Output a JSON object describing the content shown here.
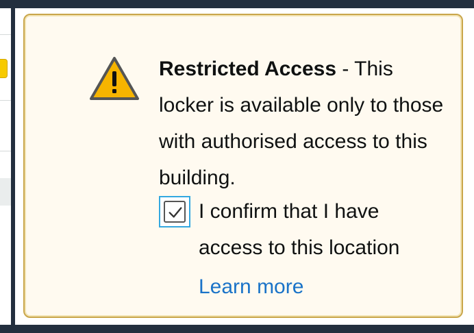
{
  "alert": {
    "type": "warning",
    "icon": "warning-triangle-icon",
    "title": "Restricted Access",
    "message": " - This locker is available only to those with authorised access to this building.",
    "confirm": {
      "checked": true,
      "label": "I confirm that I have access to this location"
    },
    "learn_more": "Learn more"
  },
  "colors": {
    "alert_background": "#fffaf0",
    "alert_border": "#c9a64a",
    "icon_yellow": "#f6b400",
    "link_blue": "#1a73c8",
    "checkbox_focus": "#33a8e0"
  }
}
